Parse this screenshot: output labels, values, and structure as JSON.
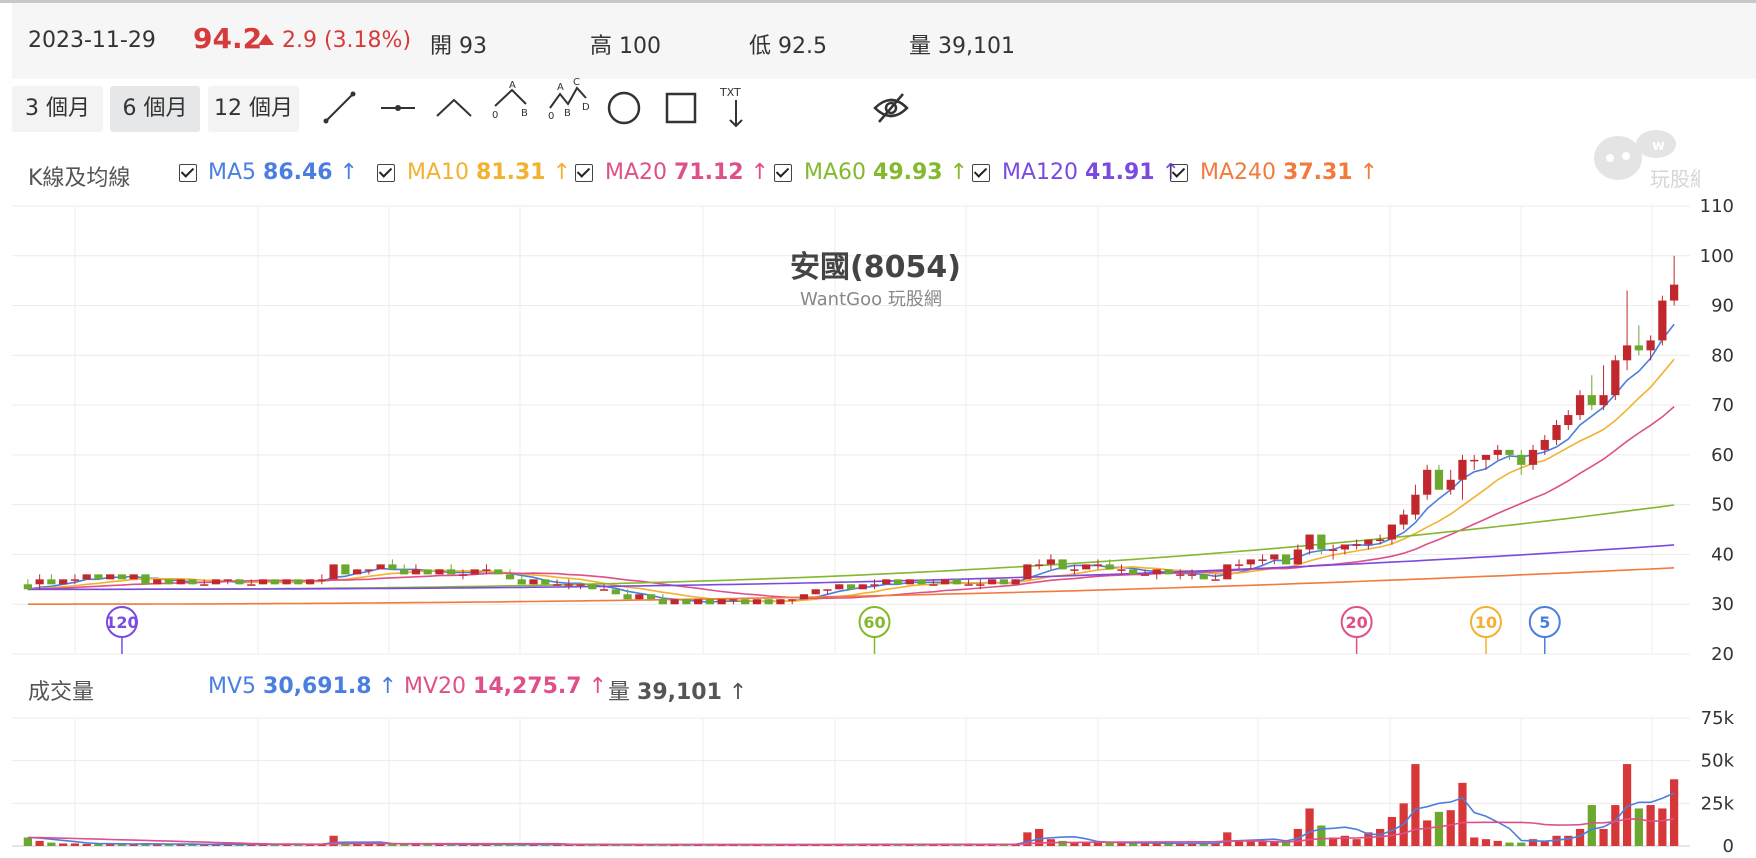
{
  "header": {
    "date": "2023-11-29",
    "price": "94.2",
    "change": "2.9 (3.18%)",
    "open_label": "開",
    "open": "93",
    "high_label": "高",
    "high": "100",
    "low_label": "低",
    "low": "92.5",
    "volume_label": "量",
    "volume": "39,101"
  },
  "ranges": [
    {
      "label": "3 個月"
    },
    {
      "label": "6 個月",
      "active": true
    },
    {
      "label": "12 個月"
    }
  ],
  "tools": [
    "trend-line-icon",
    "horizontal-line-icon",
    "angle-line-icon",
    "abc-pattern-icon",
    "abcd-pattern-icon",
    "circle-icon",
    "rectangle-icon",
    "text-icon",
    "hide-eye-icon"
  ],
  "tool_labels": {
    "a": "A",
    "b": "B",
    "c": "C",
    "d": "D",
    "zero": "0",
    "txt": "TXT"
  },
  "kline_label": "K線及均線",
  "ma": [
    {
      "name": "MA5",
      "value": "86.46",
      "color": "#4a7fe0"
    },
    {
      "name": "MA10",
      "value": "81.31",
      "color": "#f2b22f"
    },
    {
      "name": "MA20",
      "value": "71.12",
      "color": "#df4f8a"
    },
    {
      "name": "MA60",
      "value": "49.93",
      "color": "#84b82e"
    },
    {
      "name": "MA120",
      "value": "41.91",
      "color": "#7b4ae0"
    },
    {
      "name": "MA240",
      "value": "37.31",
      "color": "#f17a3d"
    }
  ],
  "chart_title": "安國(8054)",
  "chart_subtitle": "WantGoo 玩股網",
  "watermark": "玩股網",
  "volume_panel": {
    "label": "成交量",
    "mv5_name": "MV5",
    "mv5": "30,691.8",
    "mv5_color": "#4a7fe0",
    "mv20_name": "MV20",
    "mv20": "14,275.7",
    "mv20_color": "#df4f8a",
    "vol_name": "量",
    "vol": "39,101",
    "vol_color": "#555555"
  },
  "chart_data": {
    "type": "candlestick",
    "price_axis": {
      "ticks": [
        "110",
        "100",
        "90",
        "80",
        "70",
        "60",
        "50",
        "40",
        "30",
        "20"
      ],
      "ylim": [
        20,
        110
      ]
    },
    "volume_axis": {
      "ticks": [
        "75k",
        "50k",
        "25k",
        "0"
      ],
      "ylim": [
        0,
        75000
      ]
    },
    "ma_markers": [
      {
        "label": "120",
        "color": "#7b4ae0",
        "bar": 8
      },
      {
        "label": "60",
        "color": "#84b82e",
        "bar": 72
      },
      {
        "label": "20",
        "color": "#df4f8a",
        "bar": 113
      },
      {
        "label": "10",
        "color": "#f2b22f",
        "bar": 124
      },
      {
        "label": "5",
        "color": "#4a7fe0",
        "bar": 129
      }
    ],
    "candles": [
      [
        34,
        35,
        33,
        33,
        5000
      ],
      [
        34,
        36,
        33,
        35,
        3000
      ],
      [
        35,
        36,
        34,
        34,
        2000
      ],
      [
        34,
        35,
        34,
        35,
        1500
      ],
      [
        35,
        36,
        34,
        35,
        1500
      ],
      [
        35,
        36,
        35,
        36,
        1200
      ],
      [
        36,
        36,
        35,
        35,
        1200
      ],
      [
        35,
        36,
        35,
        36,
        1200
      ],
      [
        36,
        36,
        35,
        35,
        1200
      ],
      [
        35,
        36,
        35,
        36,
        1200
      ],
      [
        36,
        36,
        34,
        34,
        1500
      ],
      [
        34,
        35,
        34,
        35,
        1000
      ],
      [
        35,
        35,
        34,
        34,
        1000
      ],
      [
        34,
        35,
        34,
        35,
        1000
      ],
      [
        35,
        35,
        34,
        34,
        1000
      ],
      [
        34,
        35,
        34,
        34,
        1000
      ],
      [
        34,
        35,
        34,
        35,
        1000
      ],
      [
        35,
        35,
        34,
        35,
        1000
      ],
      [
        35,
        35,
        34,
        34,
        1000
      ],
      [
        34,
        35,
        34,
        34,
        1000
      ],
      [
        34,
        35,
        34,
        35,
        1000
      ],
      [
        35,
        35,
        34,
        34,
        1000
      ],
      [
        34,
        35,
        34,
        35,
        1000
      ],
      [
        35,
        35,
        34,
        34,
        1000
      ],
      [
        34,
        35,
        34,
        35,
        1000
      ],
      [
        35,
        36,
        34,
        35,
        1000
      ],
      [
        35,
        38,
        35,
        38,
        6000
      ],
      [
        38,
        38,
        36,
        36,
        2000
      ],
      [
        36,
        37,
        36,
        37,
        1000
      ],
      [
        37,
        37,
        36,
        37,
        1000
      ],
      [
        37,
        38,
        37,
        38,
        1500
      ],
      [
        38,
        39,
        37,
        37,
        1500
      ],
      [
        37,
        38,
        36,
        36,
        1000
      ],
      [
        36,
        38,
        36,
        37,
        1000
      ],
      [
        37,
        37,
        36,
        36,
        1000
      ],
      [
        36,
        37,
        36,
        37,
        1000
      ],
      [
        37,
        38,
        36,
        36,
        1000
      ],
      [
        36,
        37,
        35,
        36,
        1000
      ],
      [
        36,
        37,
        36,
        37,
        1000
      ],
      [
        37,
        38,
        36,
        37,
        1000
      ],
      [
        37,
        37,
        36,
        36,
        1000
      ],
      [
        36,
        37,
        35,
        35,
        1000
      ],
      [
        35,
        36,
        34,
        34,
        1000
      ],
      [
        34,
        35,
        34,
        35,
        800
      ],
      [
        35,
        35,
        34,
        34,
        800
      ],
      [
        34,
        35,
        34,
        34,
        800
      ],
      [
        34,
        35,
        33,
        34,
        800
      ],
      [
        34,
        34,
        33,
        34,
        800
      ],
      [
        34,
        34,
        33,
        33,
        800
      ],
      [
        33,
        34,
        33,
        33,
        800
      ],
      [
        33,
        33,
        32,
        32,
        800
      ],
      [
        32,
        33,
        31,
        31,
        800
      ],
      [
        31,
        32,
        31,
        32,
        800
      ],
      [
        32,
        32,
        31,
        31,
        800
      ],
      [
        31,
        32,
        30,
        30,
        800
      ],
      [
        30,
        31,
        30,
        31,
        800
      ],
      [
        31,
        31,
        30,
        30,
        800
      ],
      [
        30,
        31,
        30,
        31,
        800
      ],
      [
        31,
        31,
        30,
        30,
        800
      ],
      [
        30,
        31,
        30,
        31,
        800
      ],
      [
        31,
        31,
        30,
        31,
        800
      ],
      [
        31,
        31,
        30,
        30,
        800
      ],
      [
        30,
        31,
        30,
        31,
        800
      ],
      [
        31,
        31,
        30,
        30,
        800
      ],
      [
        30,
        31,
        30,
        31,
        800
      ],
      [
        31,
        31,
        30,
        31,
        800
      ],
      [
        31,
        32,
        31,
        32,
        800
      ],
      [
        32,
        33,
        32,
        33,
        1000
      ],
      [
        33,
        33,
        32,
        33,
        1000
      ],
      [
        33,
        34,
        33,
        34,
        1000
      ],
      [
        34,
        34,
        33,
        33,
        1000
      ],
      [
        33,
        34,
        33,
        34,
        1000
      ],
      [
        34,
        35,
        33,
        34,
        1000
      ],
      [
        34,
        35,
        34,
        35,
        1000
      ],
      [
        35,
        35,
        34,
        34,
        1000
      ],
      [
        34,
        35,
        34,
        35,
        1000
      ],
      [
        35,
        35,
        34,
        34,
        1000
      ],
      [
        34,
        35,
        34,
        34,
        1000
      ],
      [
        34,
        35,
        34,
        35,
        1000
      ],
      [
        35,
        35,
        34,
        34,
        1000
      ],
      [
        34,
        35,
        34,
        34,
        1000
      ],
      [
        34,
        35,
        33,
        34,
        1000
      ],
      [
        34,
        35,
        34,
        35,
        1000
      ],
      [
        35,
        35,
        34,
        34,
        1000
      ],
      [
        34,
        35,
        34,
        35,
        1000
      ],
      [
        35,
        38,
        35,
        38,
        8000
      ],
      [
        38,
        39,
        37,
        38,
        10000
      ],
      [
        38,
        40,
        37,
        39,
        4000
      ],
      [
        39,
        39,
        37,
        37,
        3000
      ],
      [
        37,
        38,
        36,
        37,
        2000
      ],
      [
        37,
        38,
        37,
        38,
        2000
      ],
      [
        38,
        39,
        37,
        38,
        2000
      ],
      [
        38,
        39,
        37,
        37,
        2000
      ],
      [
        37,
        38,
        36,
        37,
        2000
      ],
      [
        37,
        37,
        36,
        36,
        1500
      ],
      [
        36,
        37,
        36,
        36,
        1500
      ],
      [
        36,
        37,
        35,
        37,
        1500
      ],
      [
        37,
        37,
        36,
        36,
        1500
      ],
      [
        36,
        37,
        35,
        36,
        1500
      ],
      [
        36,
        37,
        35,
        36,
        1500
      ],
      [
        36,
        36,
        35,
        35,
        1500
      ],
      [
        35,
        36,
        35,
        35,
        1500
      ],
      [
        35,
        38,
        35,
        38,
        8000
      ],
      [
        38,
        39,
        37,
        38,
        3000
      ],
      [
        38,
        39,
        37,
        39,
        3000
      ],
      [
        39,
        40,
        38,
        39,
        3000
      ],
      [
        39,
        40,
        38,
        40,
        3000
      ],
      [
        40,
        40,
        38,
        38,
        3000
      ],
      [
        38,
        42,
        38,
        41,
        10000
      ],
      [
        41,
        44,
        40,
        44,
        22000
      ],
      [
        44,
        42,
        40,
        41,
        12000
      ],
      [
        41,
        42,
        39,
        41,
        5000
      ],
      [
        41,
        42,
        40,
        42,
        6000
      ],
      [
        42,
        43,
        41,
        42,
        4000
      ],
      [
        42,
        43,
        41,
        43,
        8000
      ],
      [
        43,
        44,
        42,
        43,
        10000
      ],
      [
        43,
        46,
        42,
        46,
        17000
      ],
      [
        46,
        49,
        45,
        48,
        25000
      ],
      [
        48,
        54,
        47,
        52,
        48000
      ],
      [
        52,
        58,
        51,
        57,
        15000
      ],
      [
        57,
        58,
        53,
        53,
        20000
      ],
      [
        53,
        57,
        52,
        55,
        21000
      ],
      [
        55,
        60,
        51,
        59,
        37000
      ],
      [
        59,
        60,
        57,
        59,
        5000
      ],
      [
        59,
        60,
        57,
        60,
        4000
      ],
      [
        60,
        62,
        59,
        61,
        3000
      ],
      [
        61,
        61,
        59,
        60,
        2000
      ],
      [
        60,
        61,
        56,
        58,
        2000
      ],
      [
        58,
        62,
        57,
        61,
        4000
      ],
      [
        61,
        64,
        60,
        63,
        3000
      ],
      [
        63,
        67,
        62,
        66,
        6000
      ],
      [
        66,
        69,
        65,
        68,
        6000
      ],
      [
        68,
        73,
        67,
        72,
        10000
      ],
      [
        72,
        76,
        69,
        70,
        24000
      ],
      [
        70,
        78,
        69,
        72,
        10000
      ],
      [
        72,
        80,
        71,
        79,
        24000
      ],
      [
        79,
        93,
        77,
        82,
        48000
      ],
      [
        82,
        86,
        80,
        81,
        22000
      ],
      [
        81,
        84,
        79,
        83,
        24000
      ],
      [
        83,
        92,
        82,
        91,
        22000
      ],
      [
        91,
        100,
        90,
        94.2,
        39101
      ]
    ]
  }
}
